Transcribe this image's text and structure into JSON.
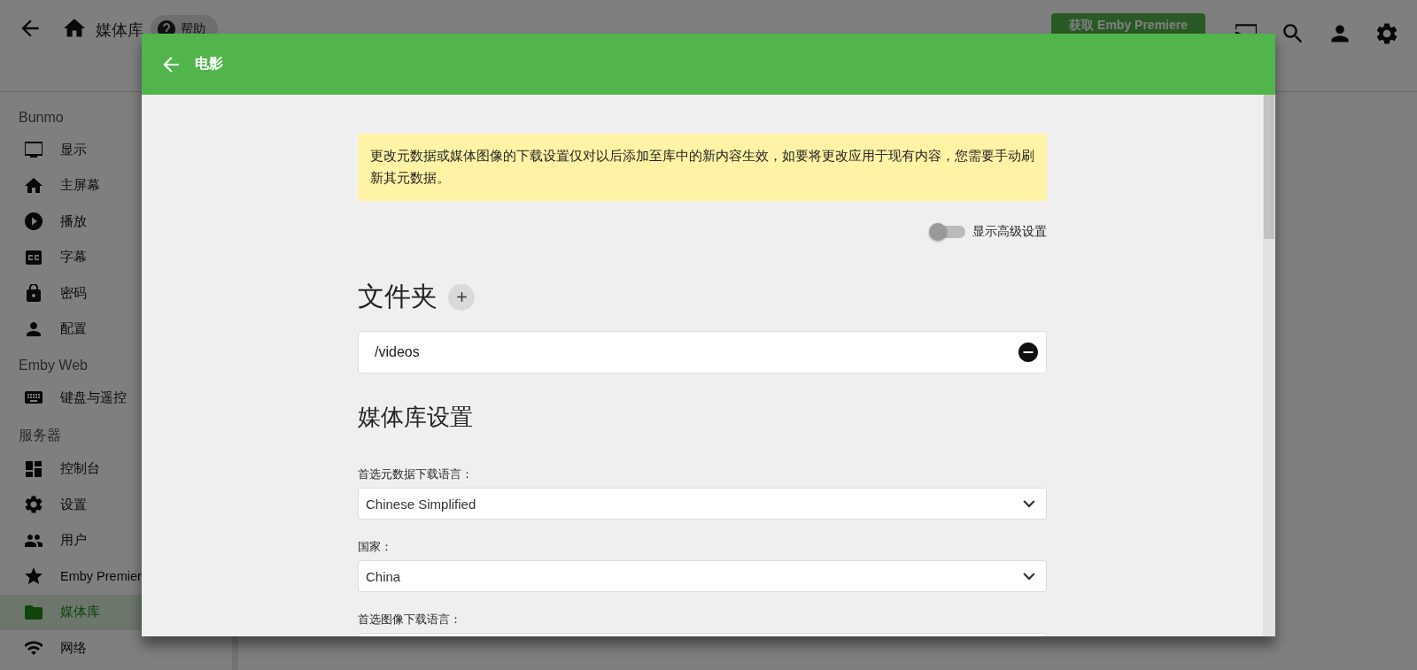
{
  "topbar": {
    "title": "媒体库",
    "help_button": "帮助",
    "premiere_button": "获取 Emby Premiere"
  },
  "sidebar": {
    "sections": [
      {
        "heading": "Bunmo",
        "items": [
          {
            "label": "显示",
            "selected": false
          },
          {
            "label": "主屏幕",
            "selected": false
          },
          {
            "label": "播放",
            "selected": false
          },
          {
            "label": "字幕",
            "selected": false
          },
          {
            "label": "密码",
            "selected": false
          },
          {
            "label": "配置",
            "selected": false
          }
        ]
      },
      {
        "heading": "Emby Web",
        "items": [
          {
            "label": "键盘与遥控",
            "selected": false
          }
        ]
      },
      {
        "heading": "服务器",
        "items": [
          {
            "label": "控制台",
            "selected": false
          },
          {
            "label": "设置",
            "selected": false
          },
          {
            "label": "用户",
            "selected": false
          },
          {
            "label": "Emby Premier",
            "selected": false
          },
          {
            "label": "媒体库",
            "selected": true
          },
          {
            "label": "网络",
            "selected": false
          }
        ]
      }
    ]
  },
  "dialog": {
    "title": "电影",
    "notice": "更改元数据或媒体图像的下载设置仅对以后添加至库中的新内容生效，如要将更改应用于现有内容，您需要手动刷新其元数据。",
    "advanced_toggle": {
      "label": "显示高级设置",
      "on": false
    },
    "folders": {
      "heading": "文件夹",
      "items": [
        "/videos"
      ]
    },
    "library_settings": {
      "heading": "媒体库设置",
      "fields": [
        {
          "label": "首选元数据下载语言：",
          "value": "Chinese Simplified"
        },
        {
          "label": "国家：",
          "value": "China"
        },
        {
          "label": "首选图像下载语言："
        }
      ]
    }
  }
}
